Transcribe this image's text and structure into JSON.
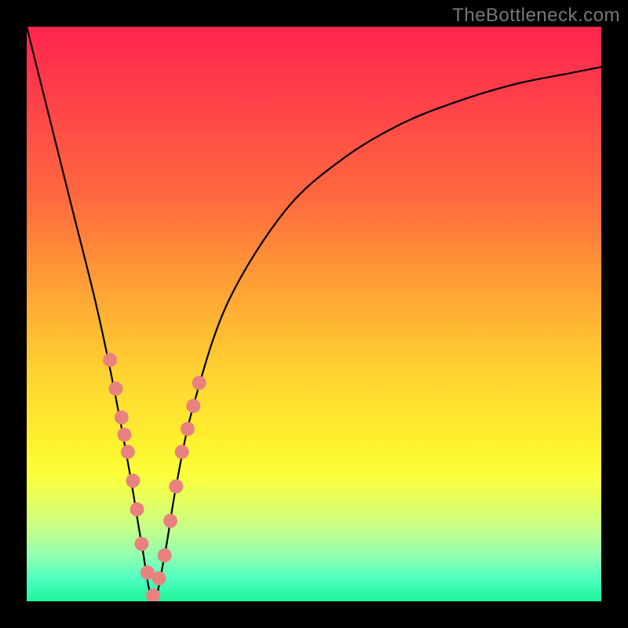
{
  "watermark": "TheBottleneck.com",
  "colors": {
    "background_frame": "#000000",
    "gradient_top": "#ff254e",
    "gradient_bottom": "#1ef59a",
    "curve": "#000000",
    "dots": "#e9827f"
  },
  "chart_data": {
    "type": "line",
    "title": "",
    "xlabel": "",
    "ylabel": "",
    "xlim": [
      0,
      100
    ],
    "ylim": [
      0,
      100
    ],
    "grid": false,
    "notes": "V-shaped bottleneck curve. Minimum (~0%) occurs near x≈22. No axis ticks or legend visible.",
    "series": [
      {
        "name": "bottleneck-curve",
        "x": [
          0,
          4,
          8,
          12,
          15,
          18,
          20,
          22,
          24,
          26,
          29,
          35,
          45,
          55,
          65,
          75,
          85,
          95,
          100
        ],
        "values": [
          100,
          84,
          68,
          52,
          38,
          22,
          10,
          0,
          8,
          20,
          34,
          52,
          68,
          77,
          83,
          87,
          90,
          92,
          93
        ]
      }
    ],
    "dots": {
      "name": "highlighted-points",
      "x": [
        14.5,
        15.5,
        16.5,
        17.0,
        17.6,
        18.5,
        19.2,
        20.0,
        21.0,
        22.0,
        23.0,
        24.0,
        25.0,
        26.0,
        27.0,
        28.0,
        29.0,
        30.0
      ],
      "values": [
        42.0,
        37.0,
        32.0,
        29.0,
        26.0,
        21.0,
        16.0,
        10.0,
        5.0,
        1.0,
        4.0,
        8.0,
        14.0,
        20.0,
        26.0,
        30.0,
        34.0,
        38.0
      ]
    }
  }
}
